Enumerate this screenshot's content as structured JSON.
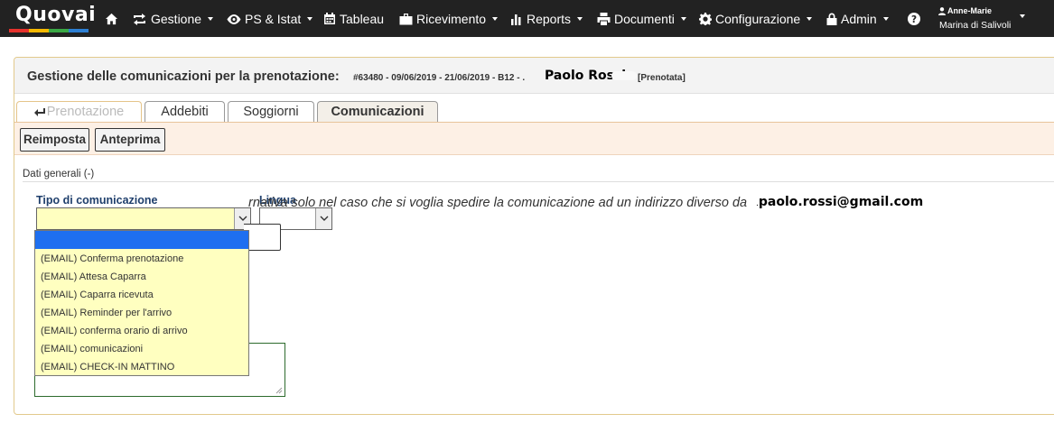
{
  "app": {
    "logo_text": "Quovai",
    "logo_colors": [
      "#e6322d",
      "#f5b800",
      "#3aa845",
      "#2d7fd3"
    ]
  },
  "navbar": {
    "home_icon": "home-icon",
    "items": [
      {
        "label": "Gestione",
        "icon": "refresh-arrows-icon",
        "dropdown": true
      },
      {
        "label": "PS & Istat",
        "icon": "eye-icon",
        "dropdown": true
      },
      {
        "label": "Tableau",
        "icon": "calendar-icon",
        "dropdown": false
      },
      {
        "label": "Ricevimento",
        "icon": "briefcase-icon",
        "dropdown": true
      },
      {
        "label": "Reports",
        "icon": "bar-chart-icon",
        "dropdown": true
      },
      {
        "label": "Documenti",
        "icon": "printer-icon",
        "dropdown": true
      },
      {
        "label": "Configurazione",
        "icon": "gear-icon",
        "dropdown": true
      },
      {
        "label": "Admin",
        "icon": "lock-icon",
        "dropdown": true
      }
    ],
    "help_icon": "question-circle-icon",
    "user": {
      "name": "Anne-Marie",
      "hotel": "Marina di Salivoli"
    }
  },
  "header": {
    "title": "Gestione delle comunicazioni per la prenotazione:",
    "details": "#63480 - 09/06/2019 - 21/06/2019 - B12 - .",
    "guest": "Paolo Rossi",
    "status": "[Prenotata]"
  },
  "tabs": [
    {
      "label": "Prenotazione",
      "state": "disabled",
      "icon": "return-arrow-icon"
    },
    {
      "label": "Addebiti",
      "state": "normal"
    },
    {
      "label": "Soggiorni",
      "state": "normal"
    },
    {
      "label": "Comunicazioni",
      "state": "active"
    }
  ],
  "toolbar": {
    "reset_label": "Reimposta",
    "preview_label": "Anteprima"
  },
  "form": {
    "section_label": "Dati generali (-)",
    "type_label": "Tipo di comunicazione",
    "type_value": "",
    "language_label": "Lingua",
    "language_value": "",
    "note_text": "rnativa solo nel caso che si voglia spedire la comunicazione ad un indirizzo diverso da",
    "note_email_prefix": ".",
    "note_email": "paolo.rossi@gmail.com"
  },
  "dropdown": {
    "options": [
      "",
      "(EMAIL) Conferma prenotazione",
      "(EMAIL) Attesa Caparra",
      "(EMAIL) Caparra ricevuta",
      "(EMAIL) Reminder per l'arrivo",
      "(EMAIL) conferma orario di arrivo",
      "(EMAIL) comunicazioni",
      "(EMAIL) CHECK-IN MATTINO"
    ],
    "selected_index": 0
  }
}
